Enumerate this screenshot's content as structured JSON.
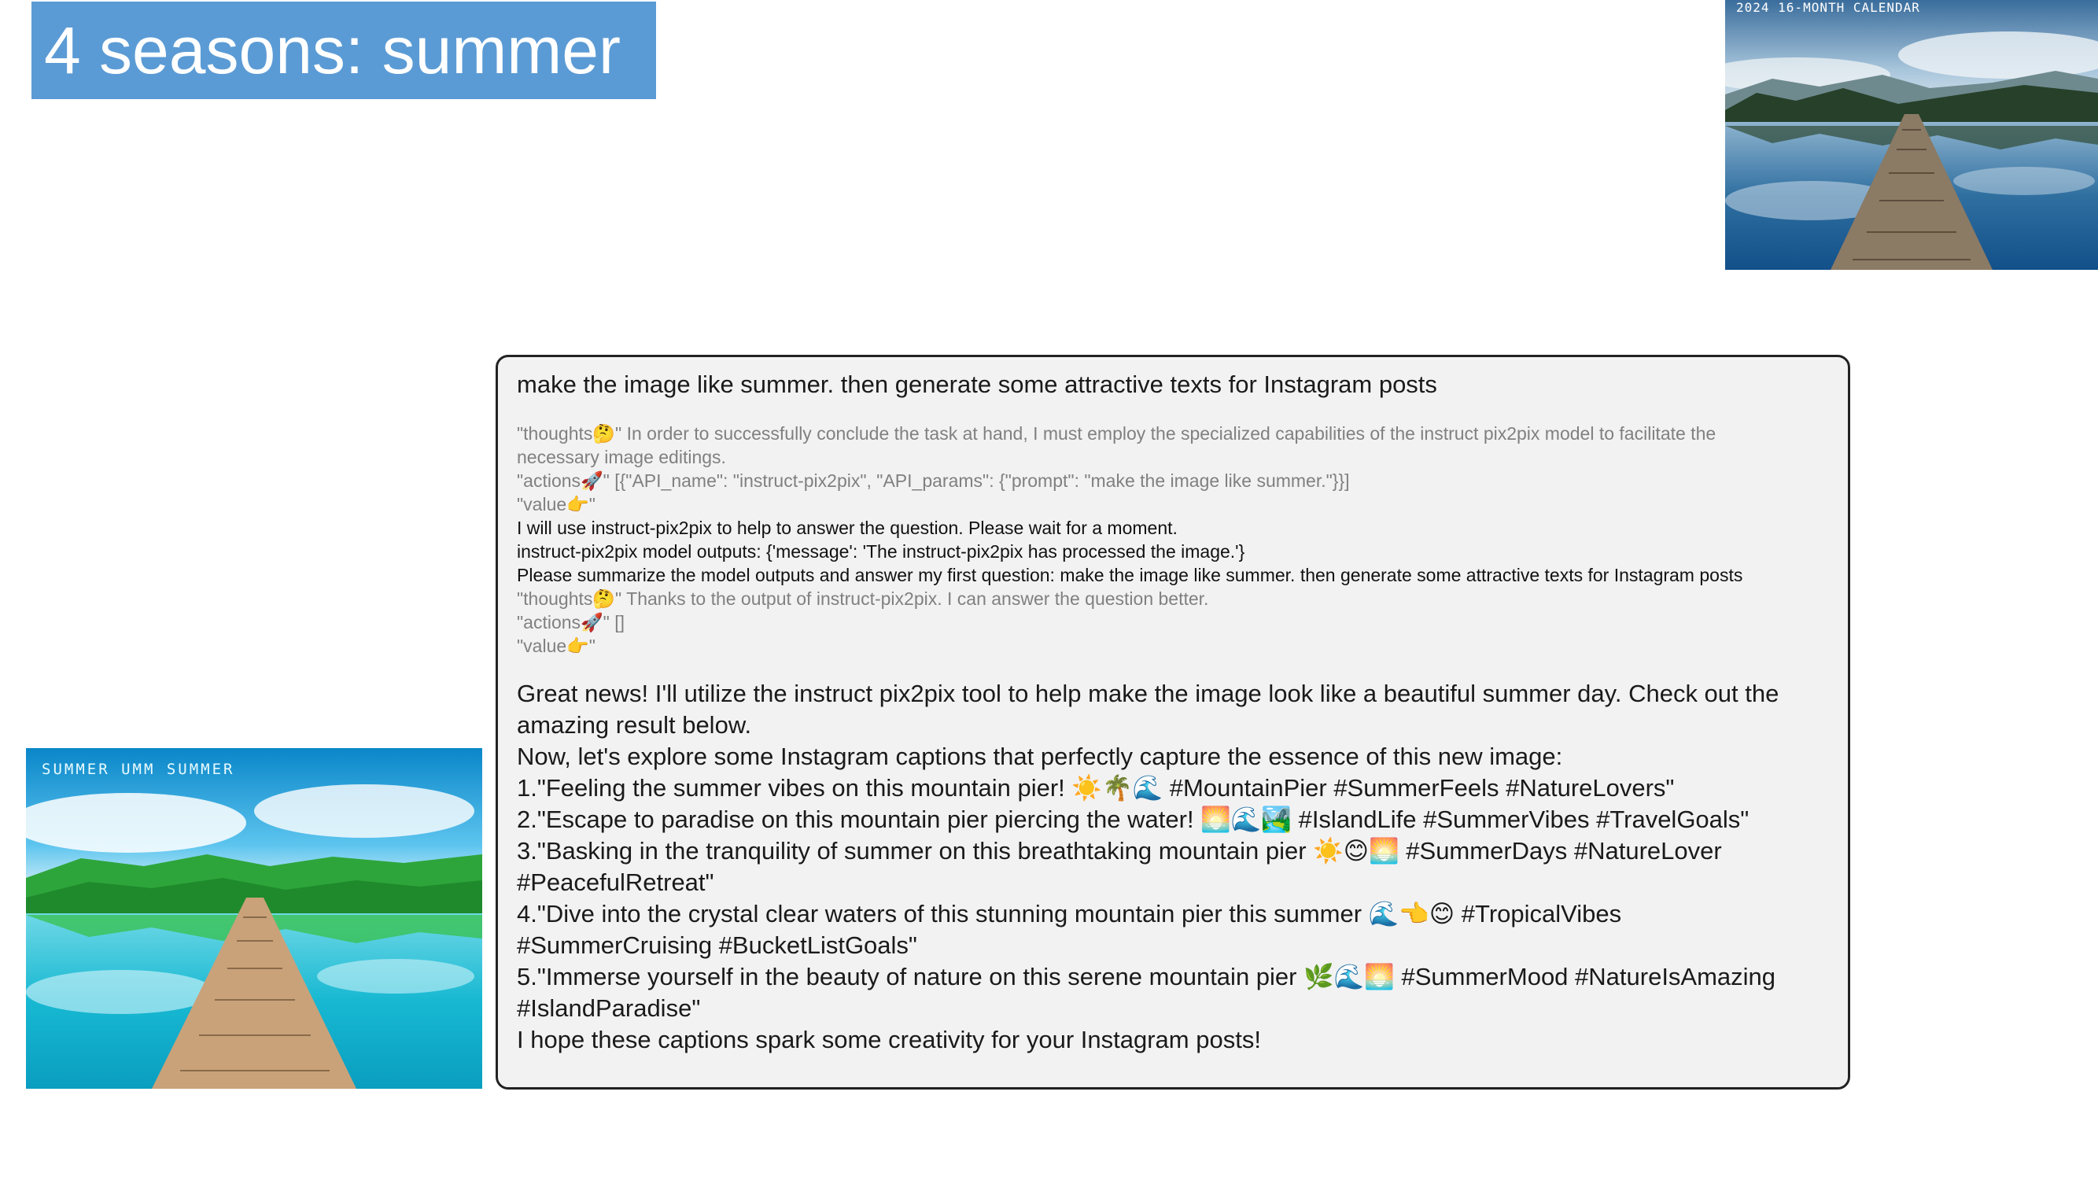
{
  "title": "4 seasons: summer",
  "photos": {
    "original_caption": "2024 16-MONTH CALENDAR",
    "edited_caption": "SUMMER UMM SUMMER"
  },
  "prompt": "make the image like summer. then generate some attractive texts for Instagram posts",
  "log": [
    {
      "text": "\"thoughts🤔\" In order to successfully conclude the task at hand, I must employ the specialized capabilities of the instruct pix2pix model to facilitate the",
      "style": "gray"
    },
    {
      "text": "necessary image editings.",
      "style": "gray"
    },
    {
      "text": "\"actions🚀\" [{\"API_name\": \"instruct-pix2pix\", \"API_params\": {\"prompt\": \"make the image like summer.\"}}]",
      "style": "gray"
    },
    {
      "text": "\"value👉\"",
      "style": "gray"
    },
    {
      "text": "I will use instruct-pix2pix to help to answer the question. Please wait for a moment.",
      "style": "dark"
    },
    {
      "text": "instruct-pix2pix model outputs: {'message': 'The instruct-pix2pix has processed the image.'}",
      "style": "dark"
    },
    {
      "text": "Please summarize the model outputs and answer my first question: make the image like summer. then generate some attractive texts for Instagram posts",
      "style": "dark"
    },
    {
      "text": "\"thoughts🤔\" Thanks to the output of instruct-pix2pix. I can answer the question better.",
      "style": "gray"
    },
    {
      "text": "\"actions🚀\" []",
      "style": "gray"
    },
    {
      "text": "\"value👉\"",
      "style": "gray"
    }
  ],
  "response": [
    "Great news! I'll utilize the instruct pix2pix tool to help make the image look like a beautiful summer day. Check out the",
    "amazing result below.",
    "Now, let's explore some Instagram captions that perfectly capture the essence of this new image:",
    "1.\"Feeling the summer vibes on this mountain pier! ☀️🌴🌊 #MountainPier #SummerFeels #NatureLovers\"",
    "2.\"Escape to paradise on this mountain pier piercing the water! 🌅🌊🏞️ #IslandLife #SummerVibes #TravelGoals\"",
    "3.\"Basking in the tranquility of summer on this breathtaking mountain pier ☀️😊🌅 #SummerDays #NatureLover",
    "#PeacefulRetreat\"",
    "4.\"Dive into the crystal clear waters of this stunning mountain pier this summer 🌊👈😊 #TropicalVibes",
    "#SummerCruising #BucketListGoals\"",
    "5.\"Immerse yourself in the beauty of nature on this serene mountain pier 🌿🌊🌅 #SummerMood #NatureIsAmazing",
    "#IslandParadise\"",
    "I hope these captions spark some creativity for your Instagram posts!"
  ]
}
